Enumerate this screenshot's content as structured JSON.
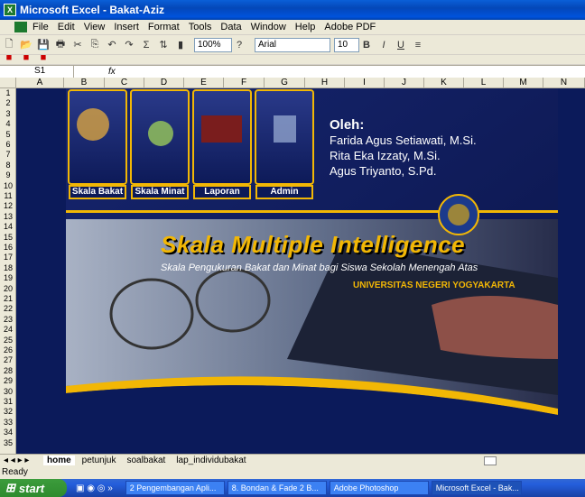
{
  "window": {
    "title": "Microsoft Excel - Bakat-Aziz"
  },
  "menu": [
    "File",
    "Edit",
    "View",
    "Insert",
    "Format",
    "Tools",
    "Data",
    "Window",
    "Help",
    "Adobe PDF"
  ],
  "toolbar": {
    "zoom": "100%",
    "font": "Arial",
    "size": "10",
    "bold": "B",
    "italic": "I",
    "underline": "U",
    "sum": "Σ"
  },
  "formula_bar": {
    "cell": "S1",
    "fx": "fx"
  },
  "columns": [
    "A",
    "B",
    "C",
    "D",
    "E",
    "F",
    "G",
    "H",
    "I",
    "J",
    "K",
    "L",
    "M",
    "N"
  ],
  "rows": [
    "1",
    "2",
    "3",
    "4",
    "5",
    "6",
    "7",
    "8",
    "9",
    "10",
    "11",
    "12",
    "13",
    "14",
    "15",
    "16",
    "17",
    "18",
    "19",
    "20",
    "21",
    "22",
    "23",
    "24",
    "25",
    "26",
    "27",
    "28",
    "29",
    "30",
    "31",
    "32",
    "33",
    "34",
    "35"
  ],
  "banner": {
    "menu": [
      "Skala Bakat",
      "Skala Minat",
      "Laporan",
      "Admin"
    ],
    "oleh_label": "Oleh:",
    "authors": [
      "Farida Agus Setiawati, M.Si.",
      "Rita Eka Izzaty, M.Si.",
      "Agus Triyanto, S.Pd."
    ],
    "title": "Skala Multiple Intelligence",
    "subtitle": "Skala Pengukuran Bakat dan Minat bagi Siswa Sekolah Menengah Atas",
    "university": "UNIVERSITAS NEGERI YOGYAKARTA",
    "accent": "#f2b705"
  },
  "sheet_tabs": [
    "home",
    "petunjuk",
    "soalbakat",
    "lap_individubakat"
  ],
  "status": "Ready",
  "taskbar": {
    "start": "start",
    "tasks": [
      "2 Pengembangan Apli...",
      "8. Bondan & Fade 2 B...",
      "Adobe Photoshop",
      "Microsoft Excel - Bak..."
    ]
  }
}
